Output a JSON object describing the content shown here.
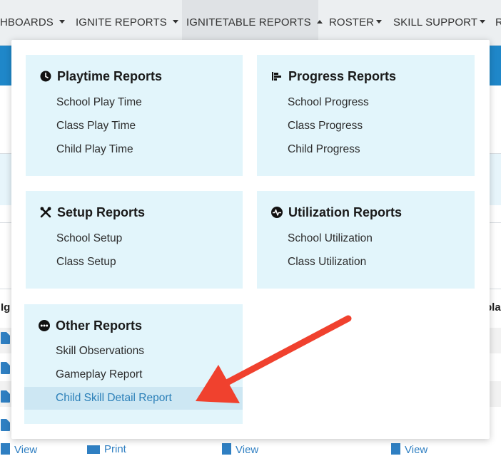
{
  "nav": {
    "items": [
      {
        "label": "HBOARDS"
      },
      {
        "label": "IGNITE REPORTS"
      },
      {
        "label": "IGNITETABLE REPORTS"
      },
      {
        "label": "ROSTER"
      },
      {
        "label": "SKILL SUPPORT"
      },
      {
        "label": "R"
      }
    ]
  },
  "background": {
    "left_header": "Ig",
    "right_header": "pla",
    "bottom_links": [
      {
        "label": "View"
      },
      {
        "label": "Print"
      },
      {
        "label": "View"
      },
      {
        "label": "View"
      }
    ]
  },
  "menu": {
    "playtime": {
      "title": "Playtime Reports",
      "icon": "clock-icon",
      "links": [
        "School Play Time",
        "Class Play Time",
        "Child Play Time"
      ]
    },
    "progress": {
      "title": "Progress Reports",
      "icon": "bar-chart-icon",
      "links": [
        "School Progress",
        "Class Progress",
        "Child Progress"
      ]
    },
    "setup": {
      "title": "Setup Reports",
      "icon": "tools-icon",
      "links": [
        "School Setup",
        "Class Setup"
      ]
    },
    "utilization": {
      "title": "Utilization Reports",
      "icon": "activity-icon",
      "links": [
        "School Utilization",
        "Class Utilization"
      ]
    },
    "other": {
      "title": "Other Reports",
      "icon": "ellipsis-icon",
      "links": [
        "Skill Observations",
        "Gameplay Report",
        "Child Skill Detail Report"
      ]
    }
  },
  "colors": {
    "card_bg": "#e2f5fb",
    "highlight_bg": "#cde7f3",
    "link_highlight": "#2a7fb8",
    "arrow": "#f0412e",
    "brand_blue": "#1f87c9"
  }
}
